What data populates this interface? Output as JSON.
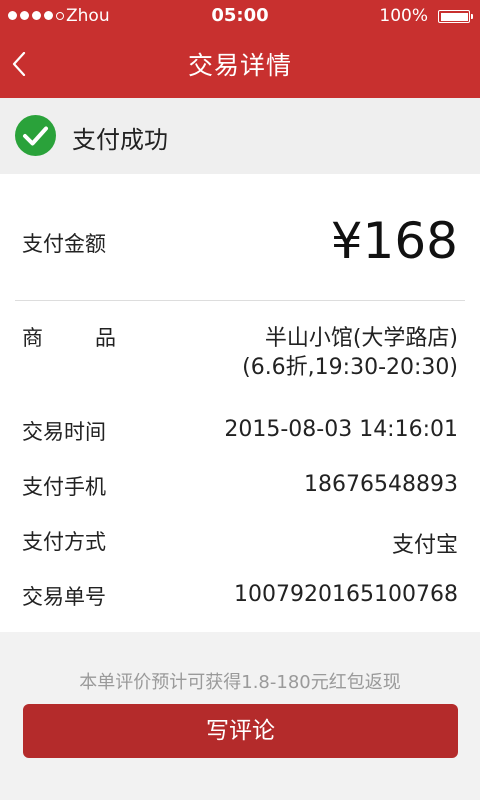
{
  "status_bar": {
    "carrier": "Zhou",
    "time": "05:00",
    "battery": "100%"
  },
  "nav": {
    "title": "交易详情"
  },
  "banner": {
    "status_text": "支付成功"
  },
  "details": {
    "amount_label": "支付金额",
    "amount_value": "¥168",
    "rows": [
      {
        "label_chars": [
          "商",
          "品"
        ],
        "value_line1": "半山小馆(大学路店)",
        "value_line2": "(6.6折,19:30-20:30)"
      },
      {
        "label": "交易时间",
        "value": "2015-08-03 14:16:01"
      },
      {
        "label": "支付手机",
        "value": "18676548893"
      },
      {
        "label": "支付方式",
        "value": "支付宝"
      },
      {
        "label": "交易单号",
        "value": "1007920165100768"
      }
    ]
  },
  "footer": {
    "hint": "本单评价预计可获得1.8-180元红包返现",
    "review_button": "写评论"
  },
  "colors": {
    "brand_red": "#c8302f",
    "button_red": "#b42b2b",
    "success_green": "#2aa23a"
  },
  "icons": {
    "back": "chevron-left-icon",
    "success": "check-circle-icon"
  }
}
